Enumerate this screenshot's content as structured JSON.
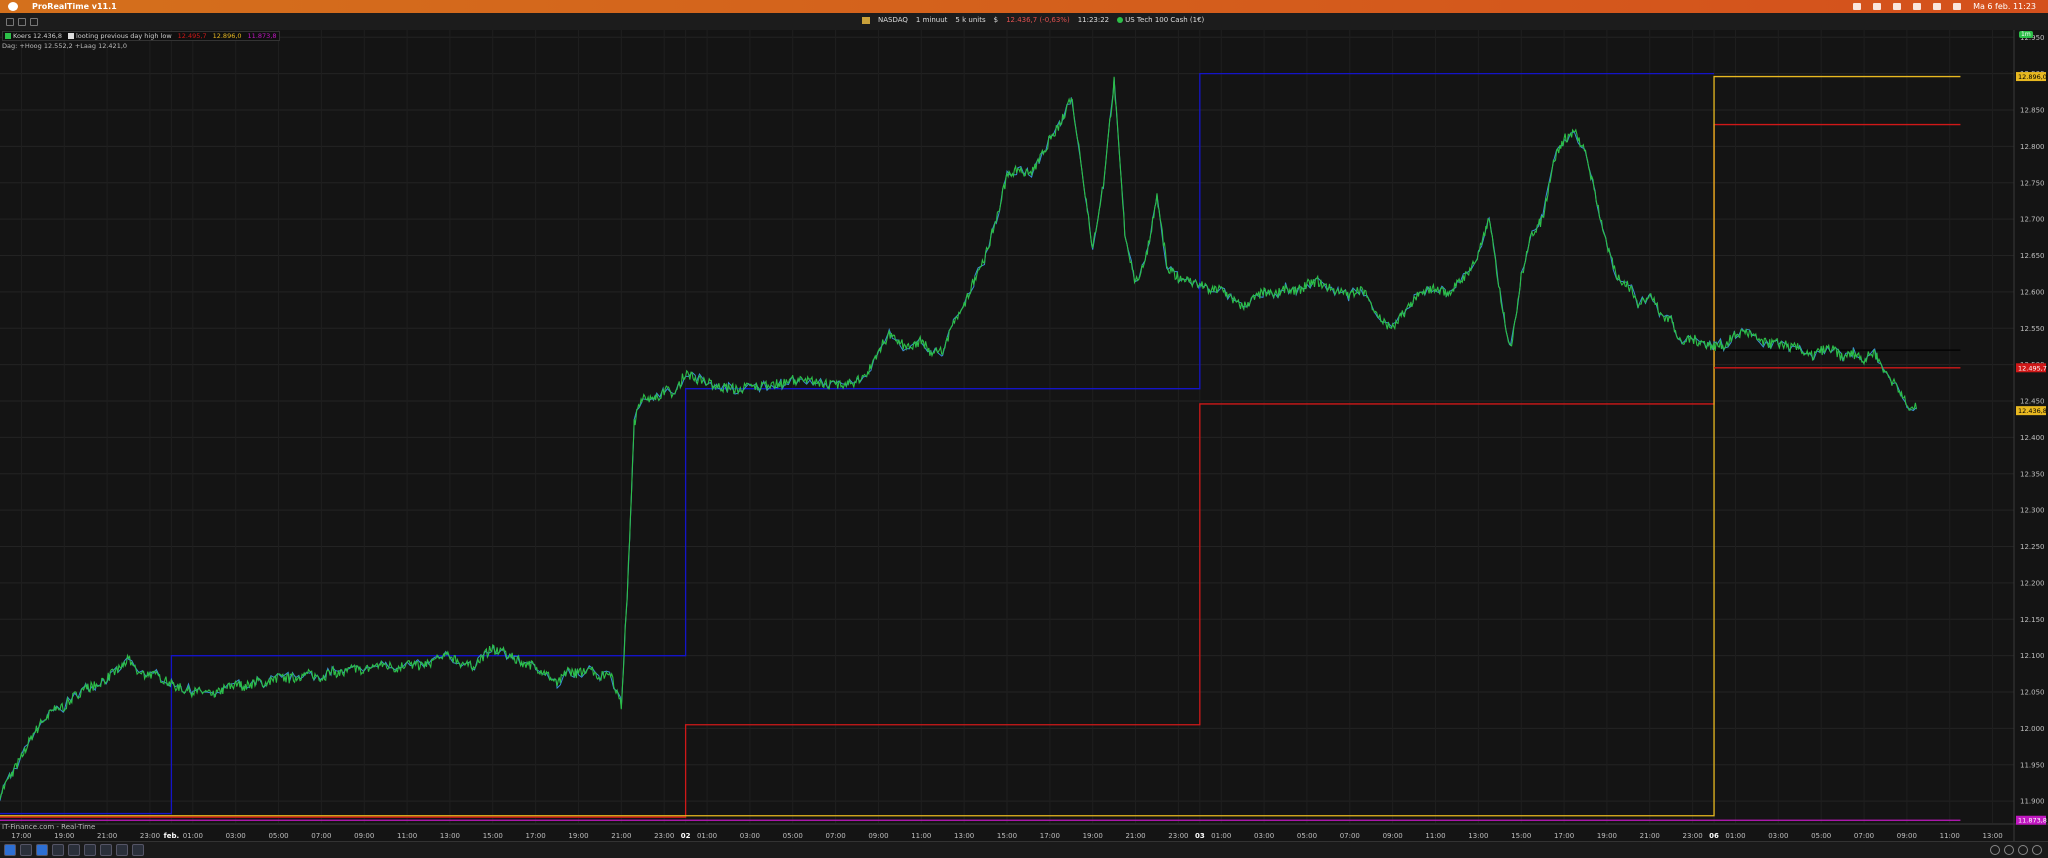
{
  "menubar": {
    "app_name": "ProRealTime v11.1",
    "datetime": "Ma 6 feb.  11:23"
  },
  "toolbar": {
    "exchange": "NASDAQ",
    "period": "1 minuut",
    "units": "5 k units",
    "dollar": "$",
    "price_change": "12.436,7 (-0,63%)",
    "time": "11:23:22",
    "instrument": "US Tech 100 Cash (1€)"
  },
  "legend": {
    "koers": "Koers 12.436,8",
    "indicator": "looting previous day high low",
    "v1": "12.495,7",
    "v2": "12.896,0",
    "v3": "11.873,8",
    "line2": "Dag: +Hoog 12.552,2 +Laag 12.421,0"
  },
  "interval_badge": "1m",
  "source": "IT-Finance.com - Real-Time",
  "price_labels": {
    "yellow": "12.896,0",
    "red": "12.495,7",
    "current": "12.436,8",
    "magenta": "11.873,8"
  },
  "colors": {
    "background": "#141414",
    "price": "#2cbf48",
    "price_alt": "#3a8fd6",
    "blue_line": "#1414c8",
    "red_line": "#d01818",
    "yellow_line": "#e8b820",
    "magenta_line": "#c018c0",
    "axis_text": "#bfbfbf"
  },
  "chart_data": {
    "type": "line",
    "ylim": [
      11870,
      12960
    ],
    "y_ticks": [
      12950,
      12900,
      12850,
      12800,
      12750,
      12700,
      12650,
      12600,
      12550,
      12500,
      12450,
      12400,
      12350,
      12300,
      12250,
      12200,
      12150,
      12100,
      12050,
      12000,
      11950,
      11900
    ],
    "y_tick_labels": [
      "12.950",
      "12.900",
      "12.850",
      "12.800",
      "12.750",
      "12.700",
      "12.650",
      "12.600",
      "12.550",
      "12.500",
      "12.450",
      "12.400",
      "12.350",
      "12.300",
      "12.250",
      "12.200",
      "12.150",
      "12.100",
      "12.050",
      "12.000",
      "11.950",
      "11.900"
    ],
    "x_ticks": [
      {
        "t": 1.0,
        "label": "17:00"
      },
      {
        "t": 3.0,
        "label": "19:00"
      },
      {
        "t": 5.0,
        "label": "21:00"
      },
      {
        "t": 7.0,
        "label": "23:00"
      },
      {
        "t": 8.0,
        "label": "feb.",
        "bold": true
      },
      {
        "t": 9.0,
        "label": "01:00"
      },
      {
        "t": 11.0,
        "label": "03:00"
      },
      {
        "t": 13.0,
        "label": "05:00"
      },
      {
        "t": 15.0,
        "label": "07:00"
      },
      {
        "t": 17.0,
        "label": "09:00"
      },
      {
        "t": 19.0,
        "label": "11:00"
      },
      {
        "t": 21.0,
        "label": "13:00"
      },
      {
        "t": 23.0,
        "label": "15:00"
      },
      {
        "t": 25.0,
        "label": "17:00"
      },
      {
        "t": 27.0,
        "label": "19:00"
      },
      {
        "t": 29.0,
        "label": "21:00"
      },
      {
        "t": 31.0,
        "label": "23:00"
      },
      {
        "t": 32.0,
        "label": "02",
        "bold": true
      },
      {
        "t": 33.0,
        "label": "01:00"
      },
      {
        "t": 35.0,
        "label": "03:00"
      },
      {
        "t": 37.0,
        "label": "05:00"
      },
      {
        "t": 39.0,
        "label": "07:00"
      },
      {
        "t": 41.0,
        "label": "09:00"
      },
      {
        "t": 43.0,
        "label": "11:00"
      },
      {
        "t": 45.0,
        "label": "13:00"
      },
      {
        "t": 47.0,
        "label": "15:00"
      },
      {
        "t": 49.0,
        "label": "17:00"
      },
      {
        "t": 51.0,
        "label": "19:00"
      },
      {
        "t": 53.0,
        "label": "21:00"
      },
      {
        "t": 55.0,
        "label": "23:00"
      },
      {
        "t": 56.0,
        "label": "03",
        "bold": true
      },
      {
        "t": 57.0,
        "label": "01:00"
      },
      {
        "t": 59.0,
        "label": "03:00"
      },
      {
        "t": 61.0,
        "label": "05:00"
      },
      {
        "t": 63.0,
        "label": "07:00"
      },
      {
        "t": 65.0,
        "label": "09:00"
      },
      {
        "t": 67.0,
        "label": "11:00"
      },
      {
        "t": 69.0,
        "label": "13:00"
      },
      {
        "t": 71.0,
        "label": "15:00"
      },
      {
        "t": 73.0,
        "label": "17:00"
      },
      {
        "t": 75.0,
        "label": "19:00"
      },
      {
        "t": 77.0,
        "label": "21:00"
      },
      {
        "t": 79.0,
        "label": "23:00"
      },
      {
        "t": 80.0,
        "label": "06",
        "bold": true
      },
      {
        "t": 81.0,
        "label": "01:00"
      },
      {
        "t": 83.0,
        "label": "03:00"
      },
      {
        "t": 85.0,
        "label": "05:00"
      },
      {
        "t": 87.0,
        "label": "07:00"
      },
      {
        "t": 89.0,
        "label": "09:00"
      },
      {
        "t": 91.0,
        "label": "11:00"
      },
      {
        "t": 93.0,
        "label": "13:00"
      }
    ],
    "x_range": [
      0.0,
      94.0
    ],
    "price_series": {
      "name": "Koers",
      "x": [
        0.0,
        0.5,
        1.0,
        1.5,
        2.0,
        2.5,
        3.0,
        3.5,
        4.0,
        4.5,
        5.0,
        5.5,
        6.0,
        6.5,
        7.0,
        7.5,
        8.0,
        8.5,
        9.0,
        9.5,
        10.0,
        10.5,
        11.0,
        11.5,
        12.0,
        12.5,
        13.0,
        13.5,
        14.0,
        14.5,
        15.0,
        15.5,
        16.0,
        16.5,
        17.0,
        17.5,
        18.0,
        18.5,
        19.0,
        19.5,
        20.0,
        20.5,
        21.0,
        21.5,
        22.0,
        22.5,
        23.0,
        23.5,
        24.0,
        24.5,
        25.0,
        25.5,
        26.0,
        26.5,
        27.0,
        27.5,
        28.0,
        28.5,
        29.0,
        29.3,
        29.6,
        30.0,
        30.5,
        31.0,
        31.5,
        32.0,
        32.5,
        33.0,
        33.5,
        34.0,
        34.5,
        35.0,
        35.5,
        36.0,
        36.5,
        37.0,
        37.5,
        38.0,
        38.5,
        39.0,
        39.5,
        40.0,
        40.5,
        41.0,
        41.5,
        42.0,
        42.5,
        43.0,
        43.5,
        44.0,
        44.5,
        45.0,
        45.5,
        46.0,
        46.5,
        47.0,
        47.5,
        48.0,
        48.5,
        49.0,
        49.5,
        50.0,
        50.5,
        51.0,
        51.5,
        52.0,
        52.5,
        53.0,
        53.5,
        54.0,
        54.5,
        55.0,
        55.5,
        56.0,
        56.5,
        57.0,
        57.5,
        58.0,
        58.5,
        59.0,
        59.5,
        60.0,
        60.5,
        61.0,
        61.5,
        62.0,
        62.5,
        63.0,
        63.5,
        64.0,
        64.5,
        65.0,
        65.5,
        66.0,
        66.5,
        67.0,
        67.5,
        68.0,
        68.5,
        69.0,
        69.5,
        70.0,
        70.5,
        71.0,
        71.5,
        72.0,
        72.5,
        73.0,
        73.5,
        74.0,
        74.5,
        75.0,
        75.5,
        76.0,
        76.5,
        77.0,
        77.5,
        78.0,
        78.5,
        79.0,
        79.5,
        80.0,
        80.5,
        81.0,
        81.5,
        82.0,
        82.5,
        83.0,
        83.5,
        84.0,
        84.5,
        85.0,
        85.5,
        86.0,
        86.5,
        87.0,
        87.5,
        88.0,
        88.5,
        89.0,
        89.5,
        90.0,
        90.5,
        91.0
      ],
      "values": [
        11910,
        11935,
        11960,
        11990,
        12010,
        12025,
        12030,
        12045,
        12055,
        12060,
        12070,
        12080,
        12095,
        12075,
        12075,
        12070,
        12060,
        12055,
        12050,
        12050,
        12045,
        12055,
        12060,
        12058,
        12065,
        12062,
        12070,
        12068,
        12072,
        12075,
        12070,
        12078,
        12075,
        12082,
        12080,
        12085,
        12088,
        12082,
        12090,
        12085,
        12090,
        12095,
        12100,
        12090,
        12085,
        12098,
        12110,
        12105,
        12095,
        12090,
        12085,
        12075,
        12060,
        12080,
        12075,
        12085,
        12070,
        12078,
        12030,
        12200,
        12420,
        12460,
        12450,
        12465,
        12460,
        12490,
        12480,
        12475,
        12470,
        12468,
        12466,
        12470,
        12470,
        12475,
        12472,
        12480,
        12476,
        12478,
        12475,
        12470,
        12472,
        12478,
        12490,
        12520,
        12540,
        12530,
        12520,
        12535,
        12515,
        12520,
        12555,
        12580,
        12620,
        12650,
        12700,
        12760,
        12770,
        12760,
        12780,
        12810,
        12830,
        12870,
        12770,
        12660,
        12750,
        12890,
        12680,
        12610,
        12650,
        12730,
        12630,
        12620,
        12615,
        12610,
        12600,
        12605,
        12590,
        12580,
        12590,
        12600,
        12595,
        12605,
        12600,
        12610,
        12615,
        12605,
        12600,
        12595,
        12605,
        12585,
        12560,
        12550,
        12570,
        12590,
        12600,
        12605,
        12598,
        12610,
        12625,
        12650,
        12700,
        12600,
        12520,
        12620,
        12680,
        12700,
        12780,
        12810,
        12820,
        12790,
        12730,
        12660,
        12620,
        12610,
        12580,
        12600,
        12570,
        12560,
        12530,
        12535,
        12530,
        12525,
        12528,
        12540,
        12545,
        12535,
        12528,
        12530,
        12525,
        12522,
        12510,
        12520,
        12522,
        12510,
        12515,
        12508,
        12516,
        12490,
        12470,
        12445,
        12440
      ]
    },
    "levels": [
      {
        "name": "blue",
        "segments": [
          {
            "x0": 0.0,
            "x1": 8.0,
            "y": 11883
          },
          {
            "x0": 8.0,
            "x1": 32.0,
            "y": 12100
          },
          {
            "x0": 32.0,
            "x1": 56.0,
            "y": 12467
          },
          {
            "x0": 56.0,
            "x1": 80.0,
            "y": 12900
          }
        ]
      },
      {
        "name": "red",
        "segments": [
          {
            "x0": 0.0,
            "x1": 32.0,
            "y": 11878
          },
          {
            "x0": 32.0,
            "x1": 56.0,
            "y": 12005
          },
          {
            "x0": 56.0,
            "x1": 80.0,
            "y": 12446
          },
          {
            "x0": 80.0,
            "x1": 91.5,
            "y": 12830
          }
        ]
      },
      {
        "name": "yellow",
        "segments": [
          {
            "x0": 0.0,
            "x1": 80.0,
            "y": 11880
          },
          {
            "x0": 80.0,
            "x1": 91.5,
            "y": 12896
          }
        ]
      },
      {
        "name": "red2",
        "segments": [
          {
            "x0": 80.0,
            "x1": 91.5,
            "y": 12495.7
          }
        ]
      },
      {
        "name": "black",
        "segments": [
          {
            "x0": 80.0,
            "x1": 91.5,
            "y": 12520
          }
        ]
      },
      {
        "name": "magenta",
        "segments": [
          {
            "x0": 0.0,
            "x1": 91.5,
            "y": 11873.8
          }
        ]
      }
    ],
    "grid": true
  }
}
